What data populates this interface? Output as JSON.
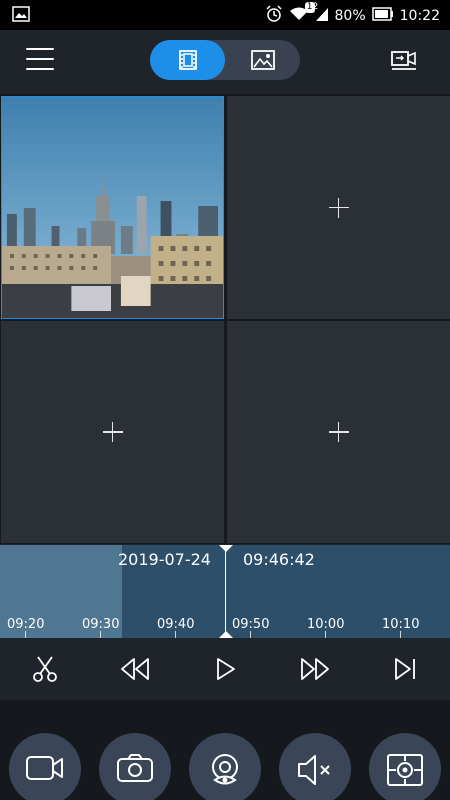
{
  "status_bar": {
    "battery": "80%",
    "time": "10:22",
    "notification_badge": "1",
    "sim_indicator": "2"
  },
  "top_bar": {
    "mode_selected": "video",
    "accent": "#1e8fe8"
  },
  "grid": {
    "cells": [
      "live-view",
      "add-camera",
      "add-camera",
      "add-camera"
    ]
  },
  "timeline": {
    "date": "2019-07-24",
    "time": "09:46:42",
    "ticks": [
      "09:20",
      "09:30",
      "09:40",
      "09:50",
      "10:00",
      "10:10"
    ]
  },
  "playback": {
    "icons": [
      "scissors-icon",
      "rewind-icon",
      "play-icon",
      "fast-forward-icon",
      "skip-end-icon"
    ]
  },
  "actions": {
    "icons": [
      "record-video-icon",
      "camera-icon",
      "eye-watch-icon",
      "mute-icon",
      "capture-icon"
    ]
  }
}
